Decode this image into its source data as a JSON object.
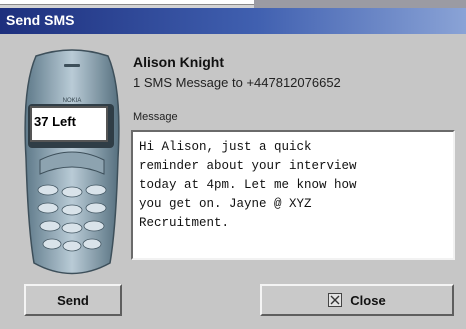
{
  "window": {
    "title": "Send SMS"
  },
  "phone": {
    "screen_text": "37 Left"
  },
  "recipient": {
    "name": "Alison Knight",
    "summary": "1 SMS Message to +447812076652"
  },
  "message": {
    "label": "Message",
    "text": "Hi Alison, just a quick\nreminder about your interview\ntoday at 4pm. Let me know how\nyou get on. Jayne @ XYZ\nRecruitment."
  },
  "buttons": {
    "send_label": "Send",
    "close_label": "Close"
  },
  "icons": {
    "close": "close-icon",
    "phone": "mobile-phone-icon"
  },
  "colors": {
    "title_bar_start": "#1d2f7d",
    "title_bar_end": "#8aa3d6",
    "dialog_bg": "#c6c6c6"
  }
}
